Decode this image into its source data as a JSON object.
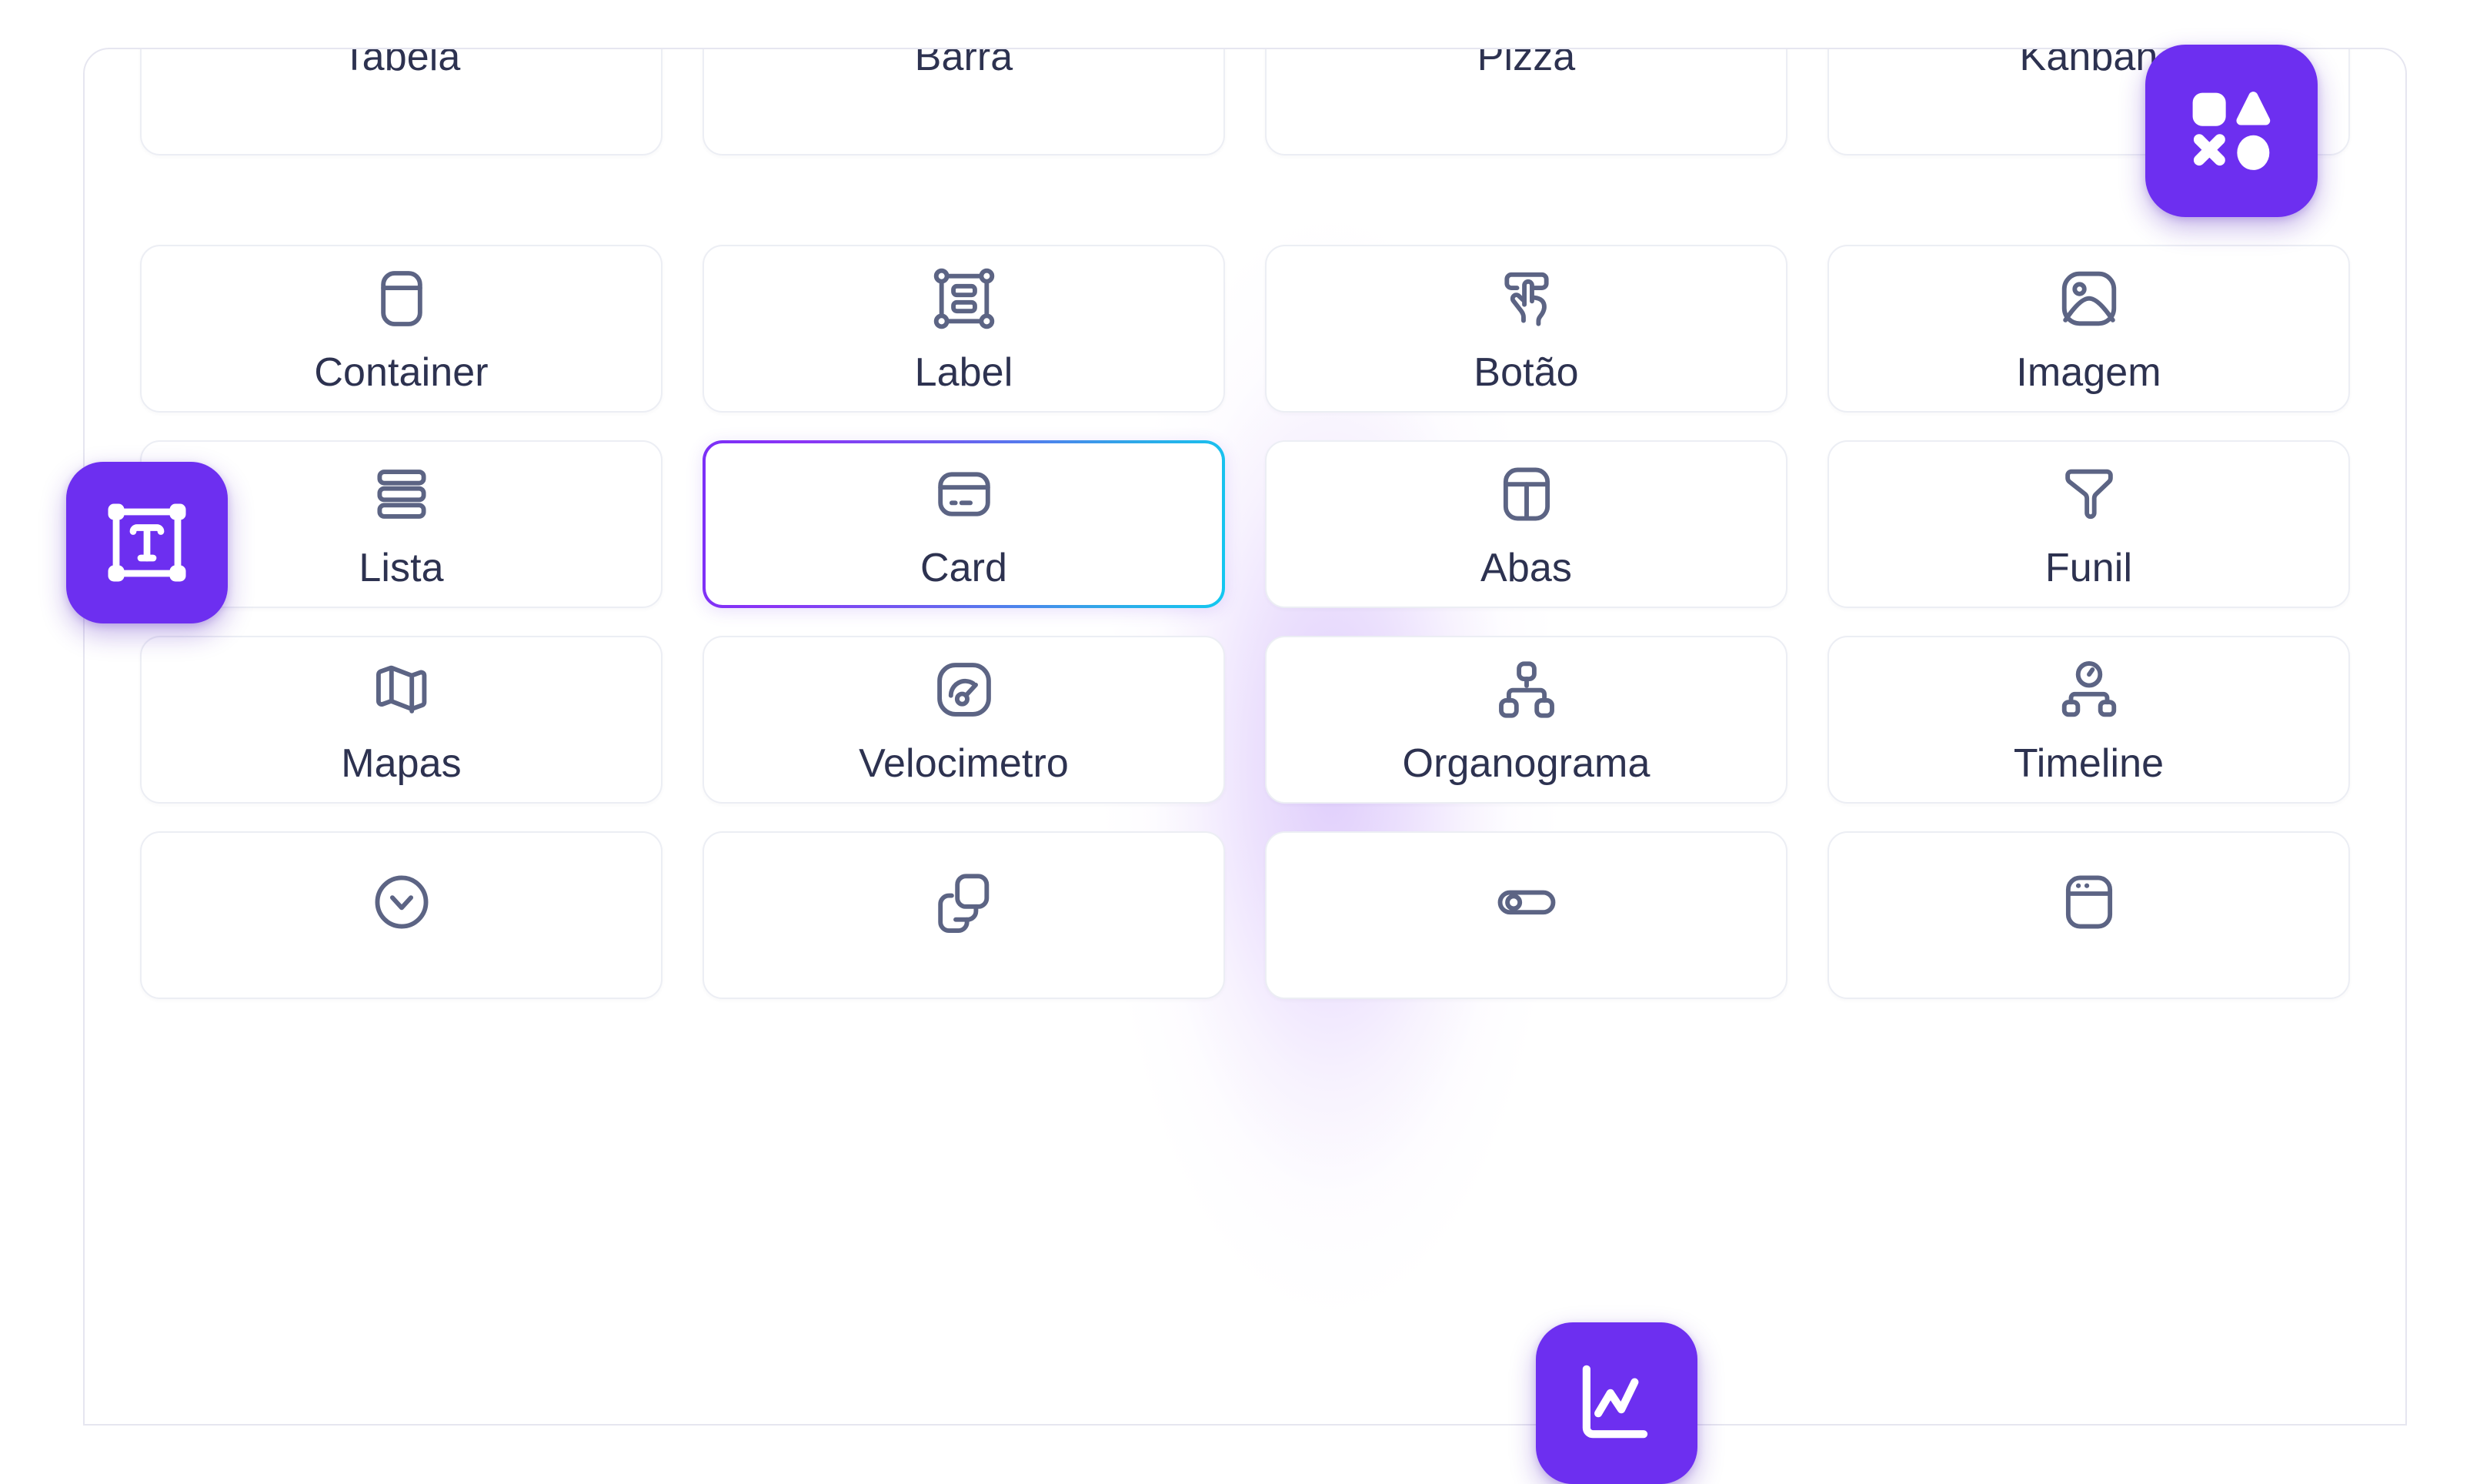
{
  "panel": {
    "name": "widget-palette",
    "selected_widget": "Card",
    "accent_purple": "#6d2ff0",
    "accent_cyan": "#12c8f0",
    "icon_color": "#5c6484",
    "label_color": "#2d3250",
    "cell_border_color": "#eceef4"
  },
  "rows": [
    {
      "clipped": "top",
      "cells": [
        {
          "label": "Tabela",
          "icon": "table-icon"
        },
        {
          "label": "Barra",
          "icon": "bar-chart-icon"
        },
        {
          "label": "Pizza",
          "icon": "pie-chart-icon"
        },
        {
          "label": "Kanban",
          "icon": "kanban-icon"
        }
      ]
    },
    {
      "clipped": "none",
      "cells": [
        {
          "label": "Container",
          "icon": "container-icon"
        },
        {
          "label": "Label",
          "icon": "label-frame-icon"
        },
        {
          "label": "Botão",
          "icon": "hand-pointer-button-icon"
        },
        {
          "label": "Imagem",
          "icon": "image-icon"
        }
      ]
    },
    {
      "clipped": "none",
      "cells": [
        {
          "label": "Lista",
          "icon": "list-icon"
        },
        {
          "label": "Card",
          "icon": "credit-card-icon",
          "selected": true
        },
        {
          "label": "Abas",
          "icon": "tabs-layout-icon"
        },
        {
          "label": "Funil",
          "icon": "funnel-icon"
        }
      ]
    },
    {
      "clipped": "none",
      "cells": [
        {
          "label": "Mapas",
          "icon": "map-icon"
        },
        {
          "label": "Velocimetro",
          "icon": "gauge-icon"
        },
        {
          "label": "Organograma",
          "icon": "org-chart-icon"
        },
        {
          "label": "Timeline",
          "icon": "timeline-clock-icon"
        }
      ]
    },
    {
      "clipped": "bottom",
      "cells": [
        {
          "label": "",
          "icon": "chevron-down-circle-icon"
        },
        {
          "label": "",
          "icon": "copy-stack-icon"
        },
        {
          "label": "",
          "icon": "toggle-switch-icon"
        },
        {
          "label": "",
          "icon": "browser-window-icon"
        }
      ]
    }
  ],
  "floating_badges": [
    {
      "id": "badge-shapes",
      "icon": "shapes-icon",
      "color": "#6d2ff0"
    },
    {
      "id": "badge-text",
      "icon": "text-frame-icon",
      "color": "#6d2ff0"
    },
    {
      "id": "badge-chart",
      "icon": "line-chart-icon",
      "color": "#6d2ff0"
    }
  ]
}
